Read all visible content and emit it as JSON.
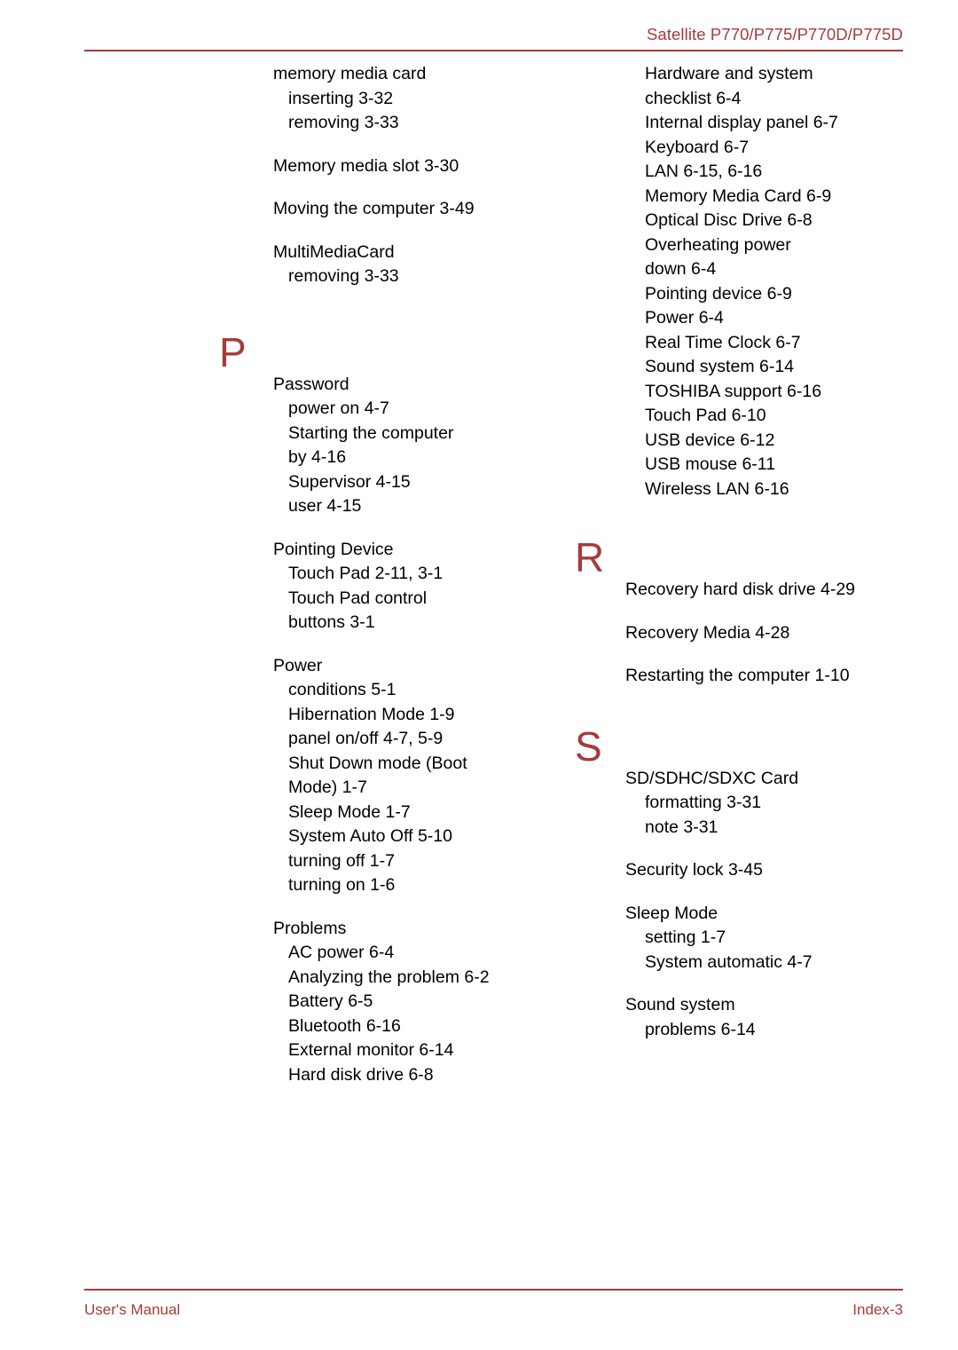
{
  "colors": {
    "accent": "#A63B3B",
    "text": "#000000",
    "background": "#FFFFFF"
  },
  "header": {
    "title": "Satellite P770/P775/P770D/P775D"
  },
  "footer": {
    "left": "User's Manual",
    "right": "Index-3"
  },
  "columns": {
    "left": {
      "groups": [
        {
          "id": "memory-media-card",
          "type": "entry-group",
          "lines": [
            {
              "text": "memory media card",
              "level": "main"
            },
            {
              "text": "inserting 3-32",
              "level": "sub"
            },
            {
              "text": "removing 3-33",
              "level": "sub"
            }
          ]
        },
        {
          "id": "memory-media-slot",
          "type": "entry-group",
          "lines": [
            {
              "text": "Memory media slot 3-30",
              "level": "main"
            }
          ]
        },
        {
          "id": "moving-the-computer",
          "type": "entry-group",
          "lines": [
            {
              "text": "Moving the computer 3-49",
              "level": "main"
            }
          ]
        },
        {
          "id": "multimediacard",
          "type": "entry-group",
          "lines": [
            {
              "text": "MultiMediaCard",
              "level": "main"
            },
            {
              "text": "removing 3-33",
              "level": "sub"
            }
          ]
        },
        {
          "id": "section-p",
          "type": "letter",
          "letter": "P"
        },
        {
          "id": "password",
          "type": "entry-group",
          "lines": [
            {
              "text": "Password",
              "level": "main"
            },
            {
              "text": "power on 4-7",
              "level": "sub"
            },
            {
              "text": "Starting the computer",
              "level": "sub"
            },
            {
              "text": "by 4-16",
              "level": "cont"
            },
            {
              "text": "Supervisor 4-15",
              "level": "sub"
            },
            {
              "text": "user 4-15",
              "level": "sub"
            }
          ]
        },
        {
          "id": "pointing-device",
          "type": "entry-group",
          "lines": [
            {
              "text": "Pointing Device",
              "level": "main"
            },
            {
              "text": "Touch Pad 2-11, 3-1",
              "level": "sub"
            },
            {
              "text": "Touch Pad control",
              "level": "sub"
            },
            {
              "text": "buttons 3-1",
              "level": "cont"
            }
          ]
        },
        {
          "id": "power",
          "type": "entry-group",
          "lines": [
            {
              "text": "Power",
              "level": "main"
            },
            {
              "text": "conditions 5-1",
              "level": "sub"
            },
            {
              "text": "Hibernation Mode 1-9",
              "level": "sub"
            },
            {
              "text": "panel on/off 4-7, 5-9",
              "level": "sub"
            },
            {
              "text": "Shut Down mode (Boot",
              "level": "sub"
            },
            {
              "text": "Mode) 1-7",
              "level": "cont"
            },
            {
              "text": "Sleep Mode 1-7",
              "level": "sub"
            },
            {
              "text": "System Auto Off 5-10",
              "level": "sub"
            },
            {
              "text": "turning off 1-7",
              "level": "sub"
            },
            {
              "text": "turning on 1-6",
              "level": "sub"
            }
          ]
        },
        {
          "id": "problems",
          "type": "entry-group",
          "lines": [
            {
              "text": "Problems",
              "level": "main"
            },
            {
              "text": "AC power 6-4",
              "level": "sub"
            },
            {
              "text": "Analyzing the problem 6-2",
              "level": "sub"
            },
            {
              "text": "Battery 6-5",
              "level": "sub"
            },
            {
              "text": "Bluetooth 6-16",
              "level": "sub"
            },
            {
              "text": "External monitor 6-14",
              "level": "sub"
            },
            {
              "text": "Hard disk drive 6-8",
              "level": "sub"
            }
          ]
        }
      ]
    },
    "right": {
      "groups": [
        {
          "id": "problems-continued",
          "type": "entry-group",
          "lines": [
            {
              "text": "Hardware and system",
              "level": "sub"
            },
            {
              "text": "checklist 6-4",
              "level": "cont"
            },
            {
              "text": "Internal display panel 6-7",
              "level": "sub"
            },
            {
              "text": "Keyboard 6-7",
              "level": "sub"
            },
            {
              "text": "LAN 6-15, 6-16",
              "level": "sub"
            },
            {
              "text": "Memory Media Card 6-9",
              "level": "sub"
            },
            {
              "text": "Optical Disc Drive 6-8",
              "level": "sub"
            },
            {
              "text": "Overheating power",
              "level": "sub"
            },
            {
              "text": "down 6-4",
              "level": "cont"
            },
            {
              "text": "Pointing device 6-9",
              "level": "sub"
            },
            {
              "text": "Power 6-4",
              "level": "sub"
            },
            {
              "text": "Real Time Clock 6-7",
              "level": "sub"
            },
            {
              "text": "Sound system 6-14",
              "level": "sub"
            },
            {
              "text": "TOSHIBA support 6-16",
              "level": "sub"
            },
            {
              "text": "Touch Pad 6-10",
              "level": "sub"
            },
            {
              "text": "USB device 6-12",
              "level": "sub"
            },
            {
              "text": "USB mouse 6-11",
              "level": "sub"
            },
            {
              "text": "Wireless LAN 6-16",
              "level": "sub"
            }
          ]
        },
        {
          "id": "section-r",
          "type": "letter",
          "letter": "R"
        },
        {
          "id": "recovery-hard-disk-drive",
          "type": "entry-group",
          "lines": [
            {
              "text": "Recovery hard disk drive 4-29",
              "level": "main"
            }
          ]
        },
        {
          "id": "recovery-media",
          "type": "entry-group",
          "lines": [
            {
              "text": "Recovery Media 4-28",
              "level": "main"
            }
          ]
        },
        {
          "id": "restarting-the-computer",
          "type": "entry-group",
          "lines": [
            {
              "text": "Restarting the computer 1-10",
              "level": "main"
            }
          ]
        },
        {
          "id": "section-s",
          "type": "letter",
          "letter": "S"
        },
        {
          "id": "sd-sdhc-sdxc-card",
          "type": "entry-group",
          "lines": [
            {
              "text": "SD/SDHC/SDXC Card",
              "level": "main"
            },
            {
              "text": "formatting 3-31",
              "level": "sub"
            },
            {
              "text": "note 3-31",
              "level": "sub"
            }
          ]
        },
        {
          "id": "security-lock",
          "type": "entry-group",
          "lines": [
            {
              "text": "Security lock 3-45",
              "level": "main"
            }
          ]
        },
        {
          "id": "sleep-mode",
          "type": "entry-group",
          "lines": [
            {
              "text": "Sleep Mode",
              "level": "main"
            },
            {
              "text": "setting 1-7",
              "level": "sub"
            },
            {
              "text": "System automatic 4-7",
              "level": "sub"
            }
          ]
        },
        {
          "id": "sound-system",
          "type": "entry-group",
          "lines": [
            {
              "text": "Sound system",
              "level": "main"
            },
            {
              "text": "problems 6-14",
              "level": "sub"
            }
          ]
        }
      ]
    }
  }
}
